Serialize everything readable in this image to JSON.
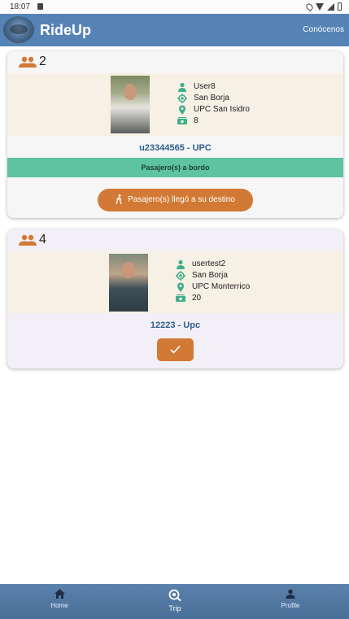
{
  "status_bar": {
    "time": "18:07"
  },
  "app_bar": {
    "title": "RideUp",
    "about_link": "Conócenos"
  },
  "colors": {
    "brand": "#5583b6",
    "accent": "#d27a35",
    "success": "#5dc3a0",
    "info_icon": "#3fae8b"
  },
  "trips": [
    {
      "passenger_count": "2",
      "driver": {
        "username": "User8",
        "origin": "San Borja",
        "destination": "UPC San Isidro",
        "price": "8"
      },
      "code": "u23344565 - UPC",
      "status": "Pasajero(s) a bordo",
      "action_label": "Pasajero(s) llegó a su destino"
    },
    {
      "passenger_count": "4",
      "driver": {
        "username": "usertest2",
        "origin": "San Borja",
        "destination": "UPC Monterrico",
        "price": "20"
      },
      "code": "12223 - Upc",
      "action_icon": "check-icon"
    }
  ],
  "bottom_nav": [
    {
      "label": "Home",
      "icon": "home-icon"
    },
    {
      "label": "Trip",
      "icon": "trip-search-icon",
      "active": true
    },
    {
      "label": "Profile",
      "icon": "person-icon"
    }
  ]
}
